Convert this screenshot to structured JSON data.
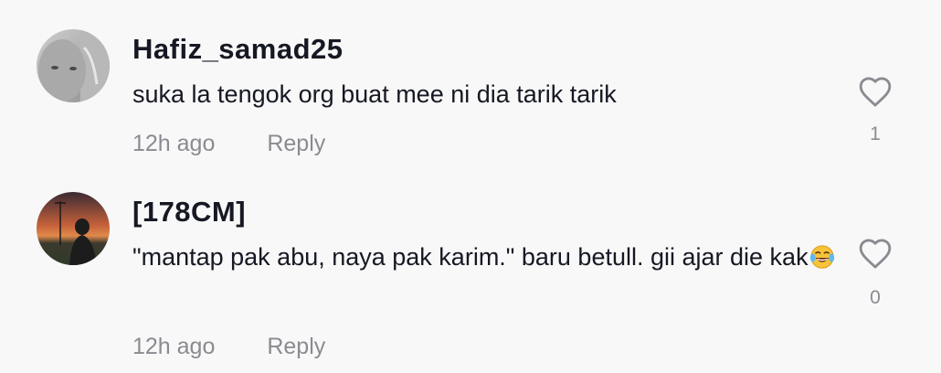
{
  "comments": [
    {
      "username": "Hafiz_samad25",
      "text": "suka la tengok org buat mee ni dia tarik tarik",
      "time": "12h ago",
      "reply_label": "Reply",
      "like_count": "1",
      "avatar_icon": "user-avatar-photo-grayscale"
    },
    {
      "username": "[178CM]",
      "text": "\"mantap pak abu, naya pak karim.\" baru betull. gii ajar die kak",
      "emoji": "face-with-tears-of-joy-emoji",
      "time": "12h ago",
      "reply_label": "Reply",
      "like_count": "0",
      "avatar_icon": "user-avatar-photo-sunset"
    }
  ],
  "icons": {
    "like": "heart-outline-icon"
  },
  "colors": {
    "background": "#f8f8f8",
    "primary_text": "#161823",
    "secondary_text": "#8a8b91"
  }
}
